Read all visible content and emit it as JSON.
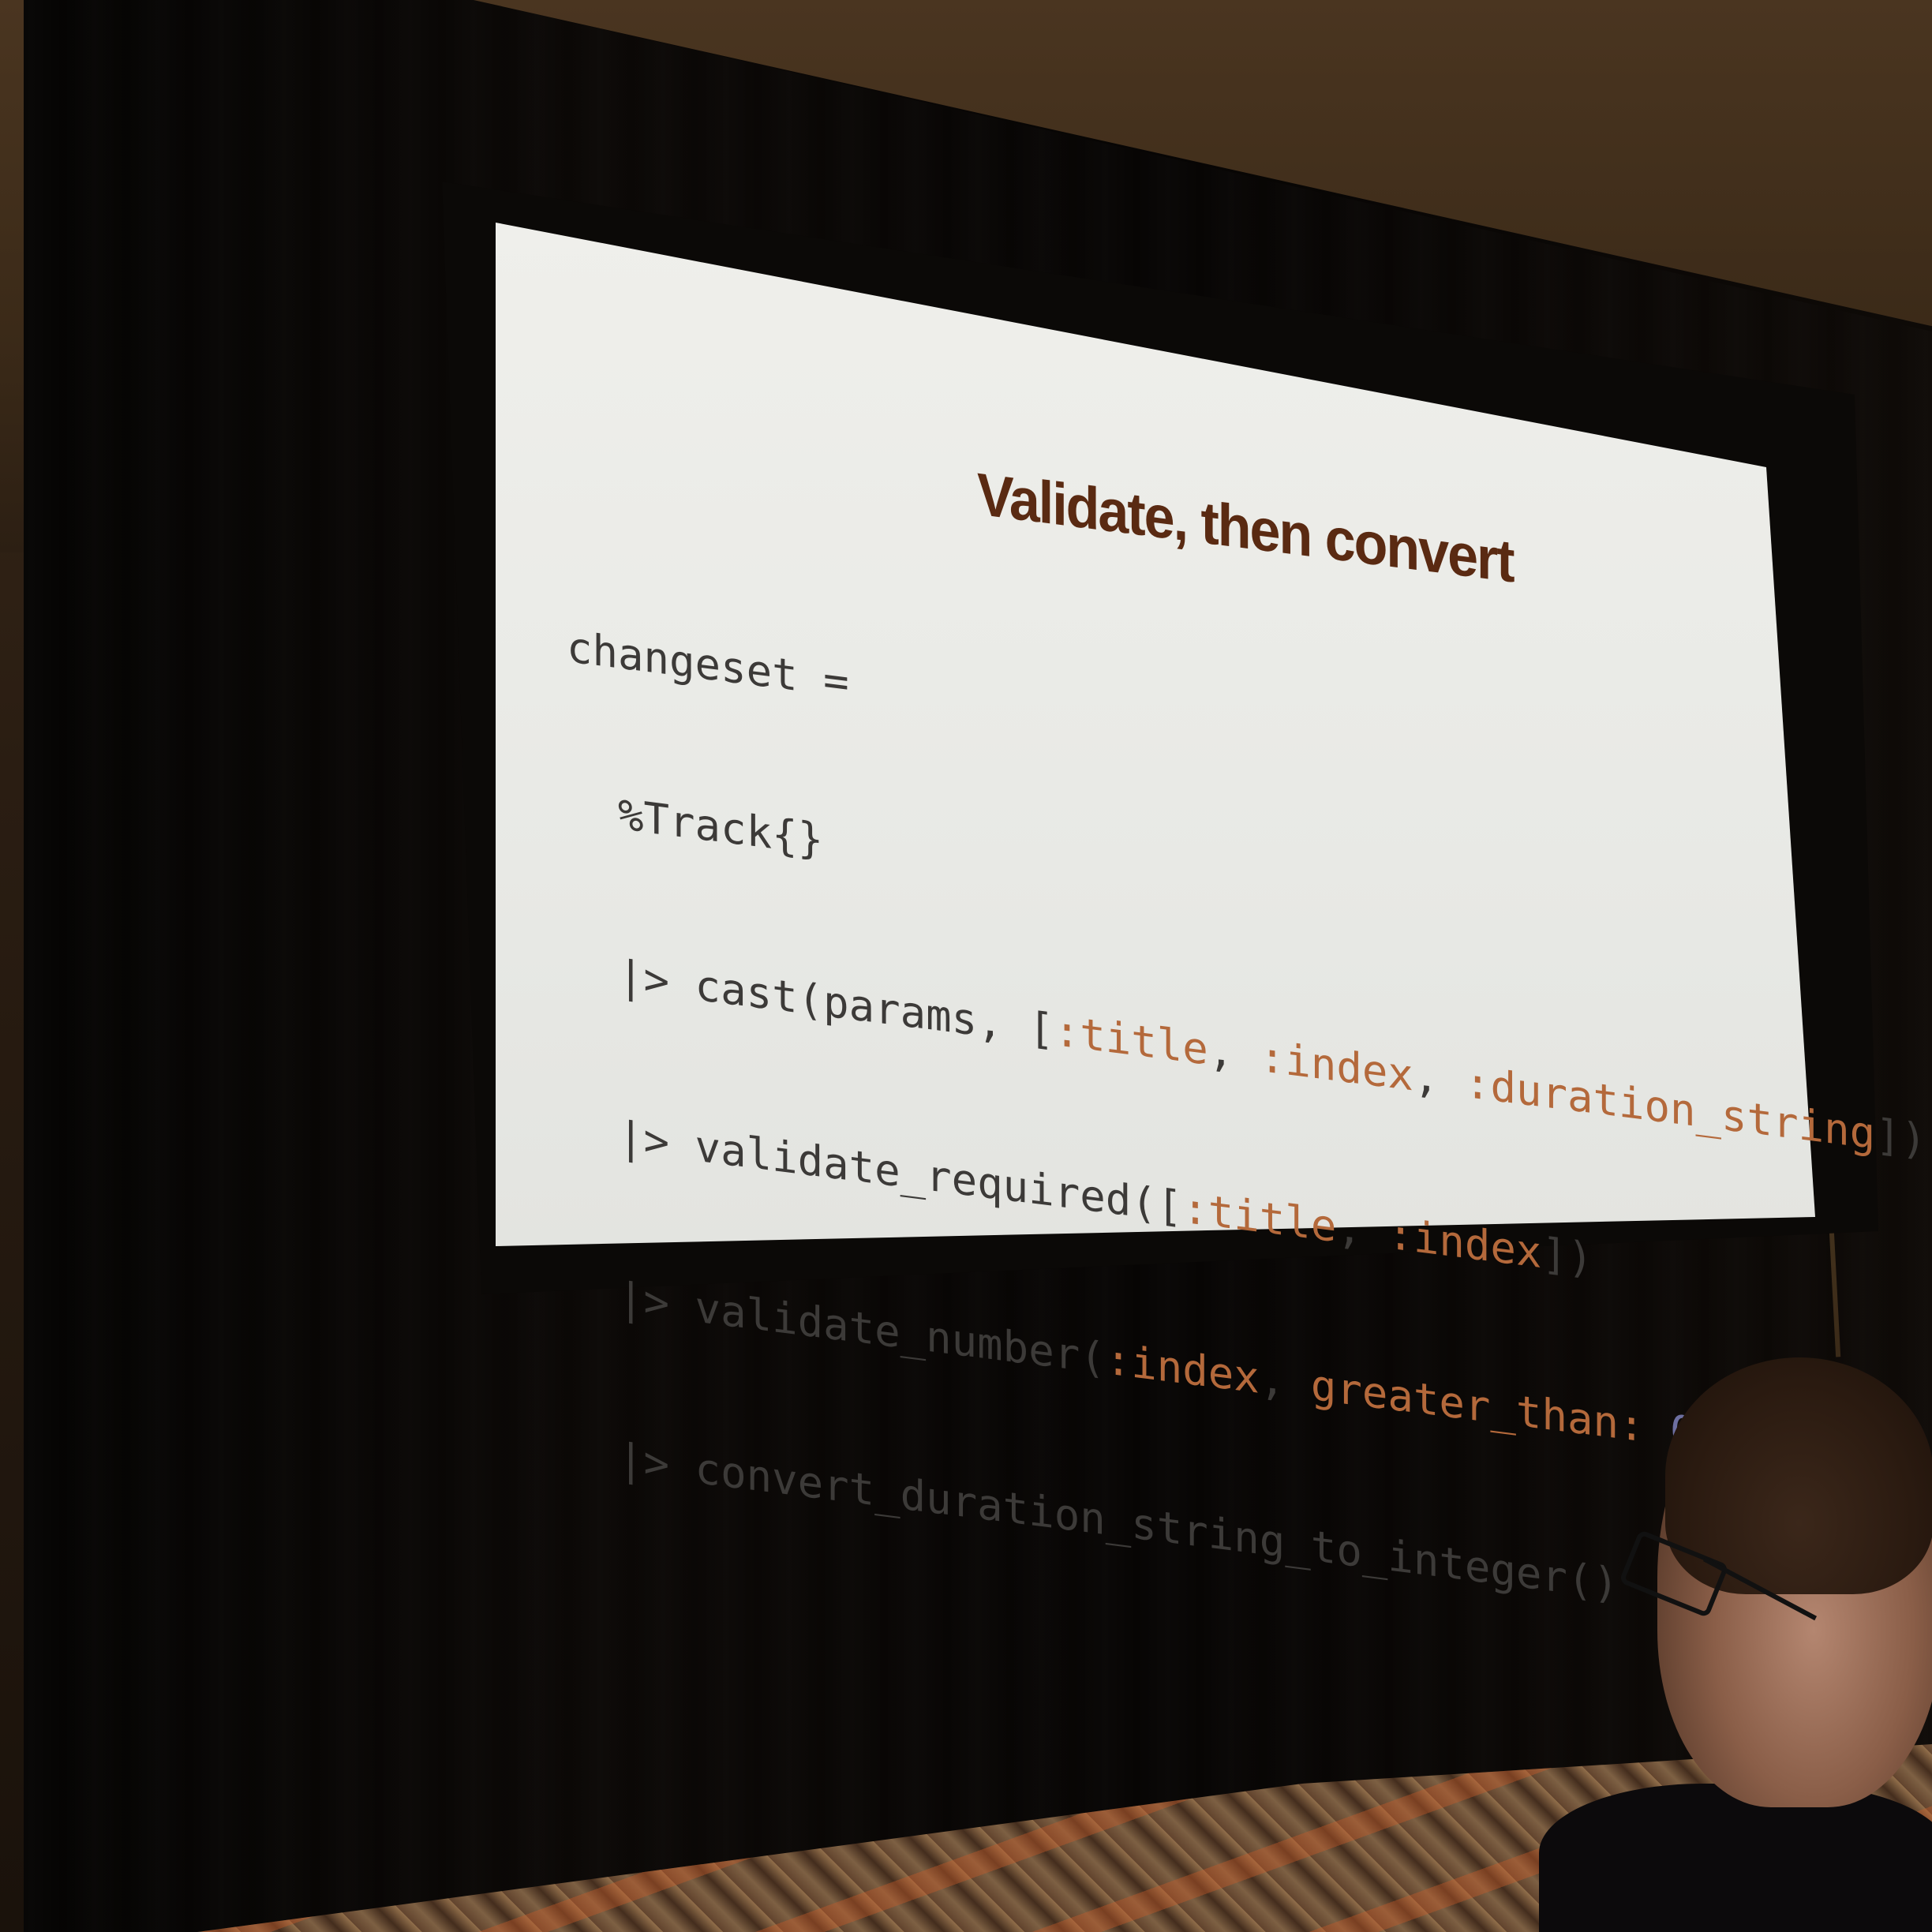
{
  "slide": {
    "title": "Validate, then convert",
    "code_lines": [
      "changeset =",
      "  %Track{}",
      "  |> cast(params, [:title, :index, :duration_string])",
      "  |> validate_required([:title, :index])",
      "  |> validate_number(:index, greater_than: 0)",
      "  |> convert_duration_string_to_integer()"
    ],
    "code": {
      "l1": "changeset =",
      "l2": "  %Track{}",
      "l3_a": "  |> cast(params, [",
      "l3_b": ":title",
      "l3_c": ", ",
      "l3_d": ":index",
      "l3_e": ", ",
      "l3_f": ":duration_string",
      "l3_g": "])",
      "l4_a": "  |> validate_required([",
      "l4_b": ":title",
      "l4_c": ", ",
      "l4_d": ":index",
      "l4_e": "])",
      "l5_a": "  |> validate_number(",
      "l5_b": ":index",
      "l5_c": ", ",
      "l5_d": "greater_than:",
      "l5_e": " ",
      "l5_f": "0",
      "l5_g": ")",
      "l6": "  |> convert_duration_string_to_integer()"
    }
  },
  "colors": {
    "title": "#5a2a12",
    "code_text": "#3c3a38",
    "code_atom": "#b4693b",
    "code_number": "#6d6fa0",
    "slide_bg": "#ecece8"
  }
}
